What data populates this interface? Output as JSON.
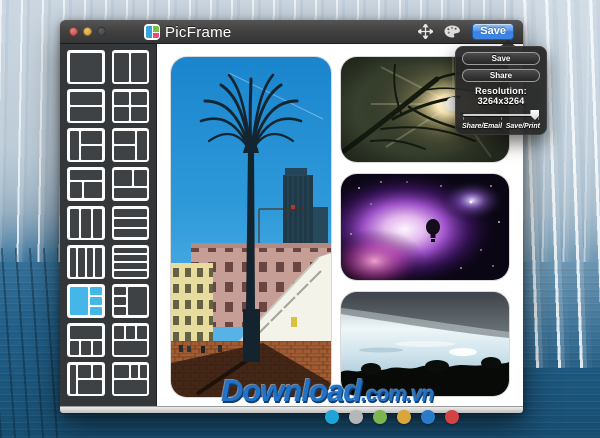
{
  "window": {
    "title": "PicFrame",
    "traffic_lights": [
      "close",
      "minimize",
      "zoom-disabled"
    ],
    "toolbar": {
      "move_icon": "move-icon",
      "palette_icon": "palette-icon",
      "save_label": "Save"
    }
  },
  "dropdown": {
    "save_label": "Save",
    "share_label": "Share",
    "resolution_label": "Resolution: 3264x3264",
    "slider_value_pct": 94,
    "left_label": "Share/Email",
    "right_label": "Save/Print"
  },
  "sidebar": {
    "selected_index": 12,
    "selected_color": "#45b6e8",
    "layouts": [
      {
        "name": "single",
        "cells": [
          [
            0,
            0,
            12,
            12
          ]
        ]
      },
      {
        "name": "two-columns",
        "cells": [
          [
            0,
            0,
            6,
            12
          ],
          [
            6,
            0,
            6,
            12
          ]
        ]
      },
      {
        "name": "two-rows",
        "cells": [
          [
            0,
            0,
            12,
            6
          ],
          [
            0,
            6,
            12,
            6
          ]
        ]
      },
      {
        "name": "grid-2x2",
        "cells": [
          [
            0,
            0,
            6,
            6
          ],
          [
            6,
            0,
            6,
            6
          ],
          [
            0,
            6,
            6,
            6
          ],
          [
            6,
            6,
            6,
            6
          ]
        ]
      },
      {
        "name": "left-col-right-two-rows",
        "cells": [
          [
            0,
            0,
            4,
            12
          ],
          [
            4,
            0,
            8,
            6
          ],
          [
            4,
            6,
            8,
            6
          ]
        ]
      },
      {
        "name": "left-two-rows-right-col",
        "cells": [
          [
            0,
            0,
            8,
            6
          ],
          [
            0,
            6,
            8,
            6
          ],
          [
            8,
            0,
            4,
            12
          ]
        ]
      },
      {
        "name": "top-row-bottom-two",
        "cells": [
          [
            0,
            0,
            12,
            5
          ],
          [
            0,
            5,
            5,
            7
          ],
          [
            5,
            5,
            7,
            7
          ]
        ]
      },
      {
        "name": "top-two-bottom-row",
        "cells": [
          [
            0,
            0,
            7,
            7
          ],
          [
            7,
            0,
            5,
            7
          ],
          [
            0,
            7,
            12,
            5
          ]
        ]
      },
      {
        "name": "three-columns",
        "cells": [
          [
            0,
            0,
            4,
            12
          ],
          [
            4,
            0,
            4,
            12
          ],
          [
            8,
            0,
            4,
            12
          ]
        ]
      },
      {
        "name": "three-rows",
        "cells": [
          [
            0,
            0,
            12,
            4
          ],
          [
            0,
            4,
            12,
            4
          ],
          [
            0,
            8,
            12,
            4
          ]
        ]
      },
      {
        "name": "four-columns",
        "cells": [
          [
            0,
            0,
            3,
            12
          ],
          [
            3,
            0,
            3,
            12
          ],
          [
            6,
            0,
            3,
            12
          ],
          [
            9,
            0,
            3,
            12
          ]
        ]
      },
      {
        "name": "four-rows",
        "cells": [
          [
            0,
            0,
            12,
            3
          ],
          [
            0,
            3,
            12,
            3
          ],
          [
            0,
            6,
            12,
            3
          ],
          [
            0,
            9,
            12,
            3
          ]
        ]
      },
      {
        "name": "big-left-three-right",
        "cells": [
          [
            0,
            0,
            7,
            12
          ],
          [
            7,
            0,
            5,
            4
          ],
          [
            7,
            4,
            5,
            4
          ],
          [
            7,
            8,
            5,
            4
          ]
        ]
      },
      {
        "name": "three-left-big-right",
        "cells": [
          [
            0,
            0,
            5,
            4
          ],
          [
            0,
            4,
            5,
            4
          ],
          [
            0,
            8,
            5,
            4
          ],
          [
            5,
            0,
            7,
            12
          ]
        ]
      },
      {
        "name": "top-row-bottom-three",
        "cells": [
          [
            0,
            0,
            12,
            6
          ],
          [
            0,
            6,
            4,
            6
          ],
          [
            4,
            6,
            4,
            6
          ],
          [
            8,
            6,
            4,
            6
          ]
        ]
      },
      {
        "name": "top-three-bottom-row",
        "cells": [
          [
            0,
            0,
            4,
            6
          ],
          [
            4,
            0,
            4,
            6
          ],
          [
            8,
            0,
            4,
            6
          ],
          [
            0,
            6,
            12,
            6
          ]
        ]
      },
      {
        "name": "left-col-two-top-bottom",
        "cells": [
          [
            0,
            0,
            3,
            12
          ],
          [
            3,
            0,
            5,
            6
          ],
          [
            8,
            0,
            4,
            6
          ],
          [
            3,
            6,
            9,
            6
          ]
        ]
      },
      {
        "name": "top-left-two-small-bottom",
        "cells": [
          [
            0,
            0,
            6,
            6
          ],
          [
            6,
            0,
            3,
            6
          ],
          [
            9,
            0,
            3,
            6
          ],
          [
            0,
            6,
            12,
            6
          ]
        ]
      }
    ]
  },
  "canvas": {
    "watermark": {
      "main": "Download",
      "suffix": ".com.vn"
    },
    "photos": [
      "city-sculpture",
      "tree-sunburst",
      "purple-nebula",
      "dusk-landscape"
    ]
  },
  "dots": {
    "colors": [
      "#1ea5d8",
      "#b5b8b9",
      "#7cb552",
      "#d9a63a",
      "#2a7cc9",
      "#d24343"
    ]
  }
}
